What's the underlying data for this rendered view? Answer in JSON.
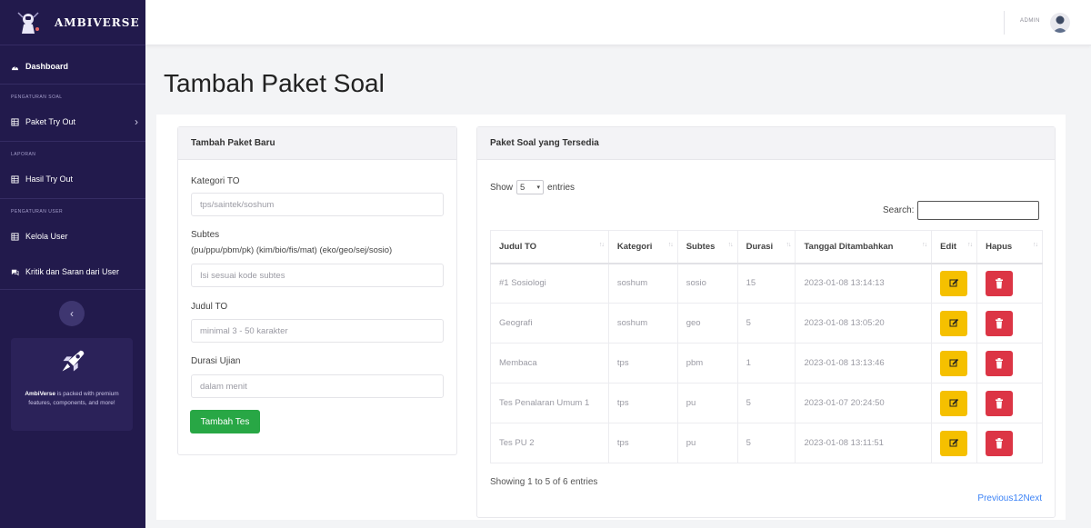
{
  "brand": {
    "name": "AMBIVERSE"
  },
  "sidebar": {
    "dashboard": "Dashboard",
    "heading_soal": "PENGATURAN SOAL",
    "paket_try_out": "Paket Try Out",
    "heading_laporan": "LAPORAN",
    "hasil_try_out": "Hasil Try Out",
    "heading_user": "PENGATURAN USER",
    "kelola_user": "Kelola User",
    "kritik_saran": "Kritik dan Saran dari User",
    "collapse": "‹",
    "promo_brand": "AmbiVerse",
    "promo_text": "is packed with premium features, components, and more!"
  },
  "topbar": {
    "admin_label": "ADMIN"
  },
  "page": {
    "title": "Tambah Paket Soal"
  },
  "form": {
    "header": "Tambah Paket Baru",
    "kategori_label": "Kategori TO",
    "kategori_placeholder": "tps/saintek/soshum",
    "subtes_label": "Subtes",
    "subtes_hint": "(pu/ppu/pbm/pk) (kim/bio/fis/mat) (eko/geo/sej/sosio)",
    "subtes_placeholder": "Isi sesuai kode subtes",
    "judul_label": "Judul TO",
    "judul_placeholder": "minimal 3 - 50 karakter",
    "durasi_label": "Durasi Ujian",
    "durasi_placeholder": "dalam menit",
    "submit": "Tambah Tes"
  },
  "table": {
    "header": "Paket Soal yang Tersedia",
    "show_label": "Show",
    "entries_label": "entries",
    "page_size": "5",
    "search_label": "Search:",
    "columns": [
      "Judul TO",
      "Kategori",
      "Subtes",
      "Durasi",
      "Tanggal Ditambahkan",
      "Edit",
      "Hapus"
    ],
    "rows": [
      [
        "#1 Sosiologi",
        "soshum",
        "sosio",
        "15",
        "2023-01-08 13:14:13"
      ],
      [
        "Geografi",
        "soshum",
        "geo",
        "5",
        "2023-01-08 13:05:20"
      ],
      [
        "Membaca",
        "tps",
        "pbm",
        "1",
        "2023-01-08 13:13:46"
      ],
      [
        "Tes Penalaran Umum 1",
        "tps",
        "pu",
        "5",
        "2023-01-07 20:24:50"
      ],
      [
        "Tes PU 2",
        "tps",
        "pu",
        "5",
        "2023-01-08 13:11:51"
      ]
    ],
    "info": "Showing 1 to 5 of 6 entries",
    "pagination": {
      "previous": "Previous",
      "page1": "1",
      "page2": "2",
      "next": "Next"
    }
  },
  "colors": {
    "sidebar_bg": "#221a4c",
    "primary_button": "#28a745",
    "edit_button": "#f5c000",
    "delete_button": "#dc3545",
    "link": "#3b82f6"
  }
}
